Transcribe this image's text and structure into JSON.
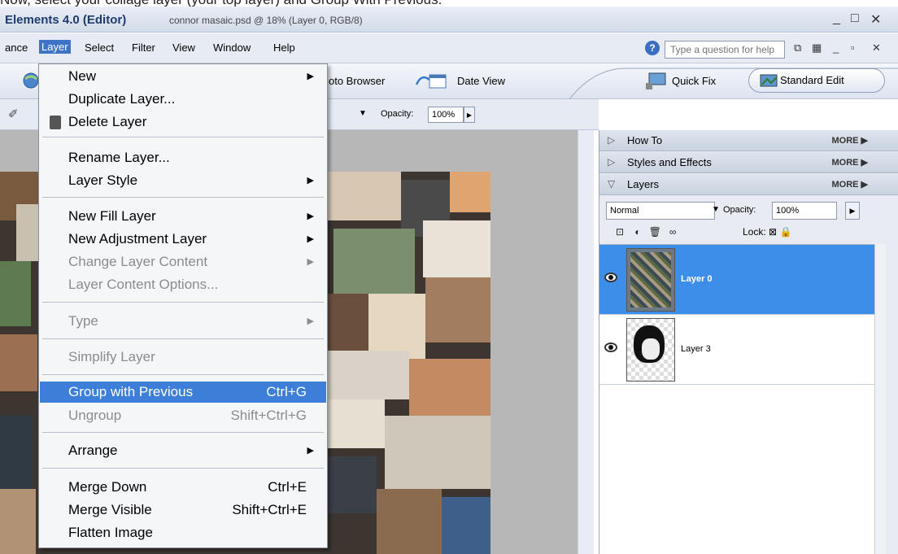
{
  "caption": "Now, select your collage layer (your top layer) and Group With Previous.",
  "titlebar": {
    "app": "Elements 4.0 (Editor)",
    "doc": "connor masaic.psd @ 18% (Layer 0, RGB/8)",
    "controls": [
      "_",
      "□",
      "✕"
    ]
  },
  "menubar": {
    "items": [
      "ance",
      "Layer",
      "Select",
      "Filter",
      "View",
      "Window",
      "Help"
    ],
    "help_placeholder": "Type a question for help",
    "mdi_controls": [
      "⧉",
      "▦",
      "_",
      "▫",
      "✕"
    ]
  },
  "shortcuts": {
    "photo_browser": "oto Browser",
    "date_view": "Date View",
    "quick_fix": "Quick Fix",
    "standard_edit": "Standard Edit"
  },
  "options": {
    "opacity_label": "Opacity:",
    "opacity_value": "100%"
  },
  "layer_menu": {
    "items": [
      {
        "label": "New",
        "submenu": true
      },
      {
        "label": "Duplicate Layer..."
      },
      {
        "label": "Delete Layer",
        "icon": "trash-icon"
      },
      {
        "label": "Rename Layer..."
      },
      {
        "label": "Layer Style",
        "submenu": true
      },
      {
        "label": "New Fill Layer",
        "submenu": true
      },
      {
        "label": "New Adjustment Layer",
        "submenu": true
      },
      {
        "label": "Change Layer Content",
        "submenu": true,
        "disabled": true
      },
      {
        "label": "Layer Content Options...",
        "disabled": true
      },
      {
        "label": "Type",
        "submenu": true,
        "disabled": true
      },
      {
        "label": "Simplify Layer",
        "disabled": true
      },
      {
        "label": "Group with Previous",
        "shortcut": "Ctrl+G",
        "highlighted": true
      },
      {
        "label": "Ungroup",
        "shortcut": "Shift+Ctrl+G",
        "disabled": true
      },
      {
        "label": "Arrange",
        "submenu": true
      },
      {
        "label": "Merge Down",
        "shortcut": "Ctrl+E"
      },
      {
        "label": "Merge Visible",
        "shortcut": "Shift+Ctrl+E"
      },
      {
        "label": "Flatten Image"
      }
    ]
  },
  "panel": {
    "sections": [
      {
        "title": "How To",
        "more": "MORE"
      },
      {
        "title": "Styles and Effects",
        "more": "MORE"
      },
      {
        "title": "Layers",
        "more": "MORE"
      }
    ],
    "blend_mode": "Normal",
    "opacity_label": "Opacity:",
    "opacity_value": "100%",
    "lock_label": "Lock:",
    "layers": [
      {
        "name": "Layer 0",
        "selected": true
      },
      {
        "name": "Layer 3",
        "selected": false
      }
    ]
  },
  "colors": {
    "menu_highlight": "#3d7ed8",
    "layer_selected": "#3d8ee8",
    "title_text": "#1f3b6e"
  }
}
